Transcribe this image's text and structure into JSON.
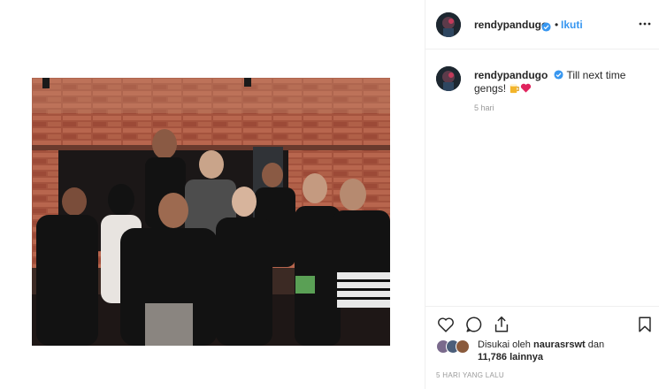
{
  "post": {
    "username": "rendypandugo",
    "separator": "•",
    "follow_label": "Ikuti",
    "caption_text": "Till next time gengs!",
    "caption_emojis": [
      "beer-mug",
      "red-heart"
    ],
    "comment_age": "5 hari",
    "liked_by_prefix": "Disukai oleh",
    "liked_by_user": "naurasrswt",
    "liked_by_joiner": "dan",
    "others_count": "11,786 lainnya",
    "timestamp": "5 HARI YANG LALU"
  },
  "icons": {
    "verified": "verified-badge-icon",
    "more": "more-options-icon",
    "like": "heart-icon",
    "comment": "comment-icon",
    "share": "share-icon",
    "save": "bookmark-icon"
  },
  "colors": {
    "link_blue": "#3897f0",
    "verified_blue": "#3897f0",
    "meta_gray": "#999999",
    "text": "#262626",
    "divider": "#efefef"
  }
}
